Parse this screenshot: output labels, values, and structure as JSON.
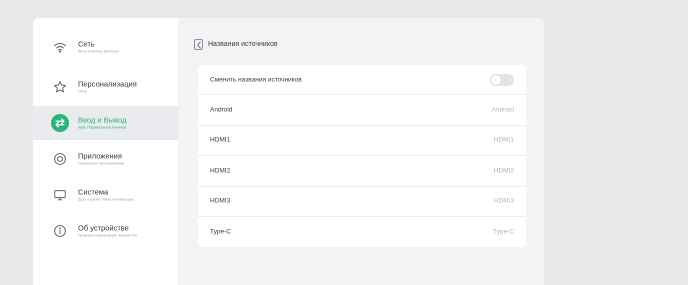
{
  "sidebar": {
    "items": [
      {
        "icon": "wifi-icon",
        "title": "Сеть",
        "subtitle": "Wi-Fi, Ethernet, Bluetooth",
        "active": false
      },
      {
        "icon": "star-icon",
        "title": "Персонализация",
        "subtitle": "Обои",
        "active": false
      },
      {
        "icon": "input-output-icon",
        "title": "Ввод и Вывод",
        "subtitle": "Звук, Параметры источников",
        "active": true
      },
      {
        "icon": "apps-icon",
        "title": "Приложения",
        "subtitle": "Управление приложениями",
        "active": false
      },
      {
        "icon": "monitor-icon",
        "title": "Система",
        "subtitle": "Дата и время, Язык и клавиатура",
        "active": false
      },
      {
        "icon": "info-icon",
        "title": "Об устройстве",
        "subtitle": "Правовая информация, Версия ПО",
        "active": false
      }
    ]
  },
  "header": {
    "title": "Названия источников"
  },
  "settings": {
    "rename_toggle_label": "Сменить названия источников",
    "rename_toggle_on": false,
    "sources": [
      {
        "label": "Android",
        "value": "Android"
      },
      {
        "label": "HDMI1",
        "value": "HDMI1"
      },
      {
        "label": "HDMI2",
        "value": "HDMI2"
      },
      {
        "label": "HDMI3",
        "value": "HDMI3"
      },
      {
        "label": "Type-C",
        "value": "Type-C"
      }
    ]
  },
  "colors": {
    "accent": "#2bb37b",
    "sidebar_active_bg": "#e9ebee",
    "panel_bg": "#f3f3f5",
    "page_bg": "#e8e8ea"
  }
}
